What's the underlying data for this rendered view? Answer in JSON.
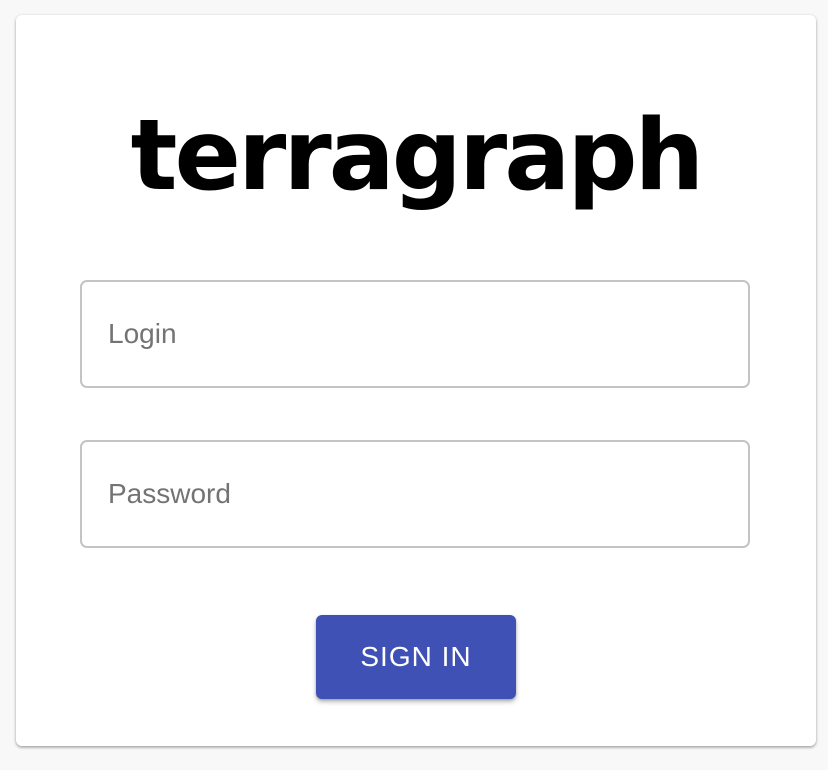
{
  "brand": {
    "logo_text": "terragraph"
  },
  "login_form": {
    "login_placeholder": "Login",
    "login_value": "",
    "password_placeholder": "Password",
    "password_value": "",
    "submit_label": "SIGN IN"
  },
  "colors": {
    "primary": "#3f51b5",
    "background": "#f8f8f8",
    "card": "#ffffff",
    "field_border": "#c4c4c4"
  }
}
